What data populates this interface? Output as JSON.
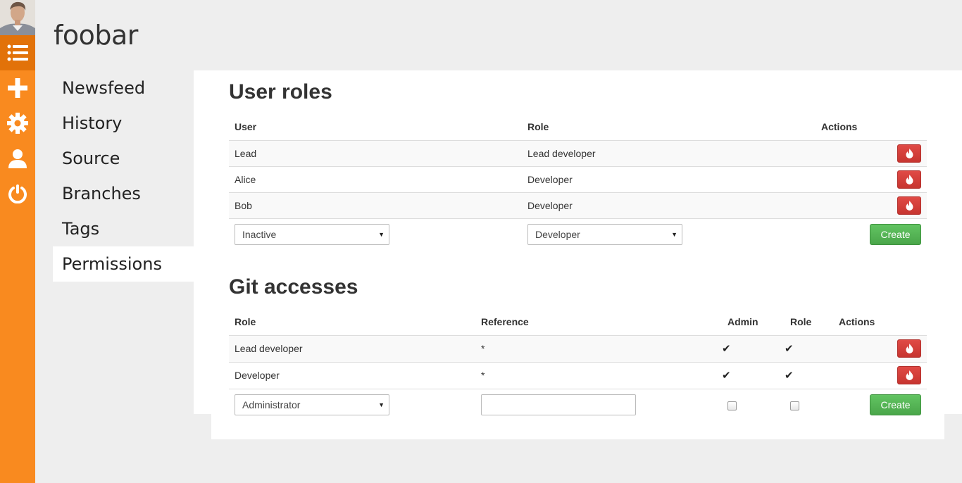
{
  "project": {
    "title": "foobar"
  },
  "iconbar": {
    "avatar": "user-avatar",
    "icons": [
      "list-icon",
      "plus-icon",
      "gear-icon",
      "user-icon",
      "power-icon"
    ],
    "color": "#f98a1f",
    "active_color": "#e27209"
  },
  "nav": {
    "items": [
      {
        "label": "Newsfeed"
      },
      {
        "label": "History"
      },
      {
        "label": "Source"
      },
      {
        "label": "Branches"
      },
      {
        "label": "Tags"
      },
      {
        "label": "Permissions"
      }
    ],
    "active": "Permissions"
  },
  "user_roles": {
    "title": "User roles",
    "headers": {
      "user": "User",
      "role": "Role",
      "actions": "Actions"
    },
    "rows": [
      {
        "user": "Lead",
        "role": "Lead developer"
      },
      {
        "user": "Alice",
        "role": "Developer"
      },
      {
        "user": "Bob",
        "role": "Developer"
      }
    ],
    "form": {
      "user_select": "Inactive",
      "role_select": "Developer",
      "create_label": "Create"
    }
  },
  "git_accesses": {
    "title": "Git accesses",
    "headers": {
      "role": "Role",
      "reference": "Reference",
      "admin": "Admin",
      "role2": "Role",
      "actions": "Actions"
    },
    "rows": [
      {
        "role": "Lead developer",
        "reference": "*",
        "admin": "✔",
        "role_flag": "✔"
      },
      {
        "role": "Developer",
        "reference": "*",
        "admin": "✔",
        "role_flag": "✔"
      }
    ],
    "form": {
      "role_select": "Administrator",
      "reference_value": "",
      "create_label": "Create"
    }
  },
  "colors": {
    "danger": "#d9433e",
    "success": "#58b558"
  }
}
